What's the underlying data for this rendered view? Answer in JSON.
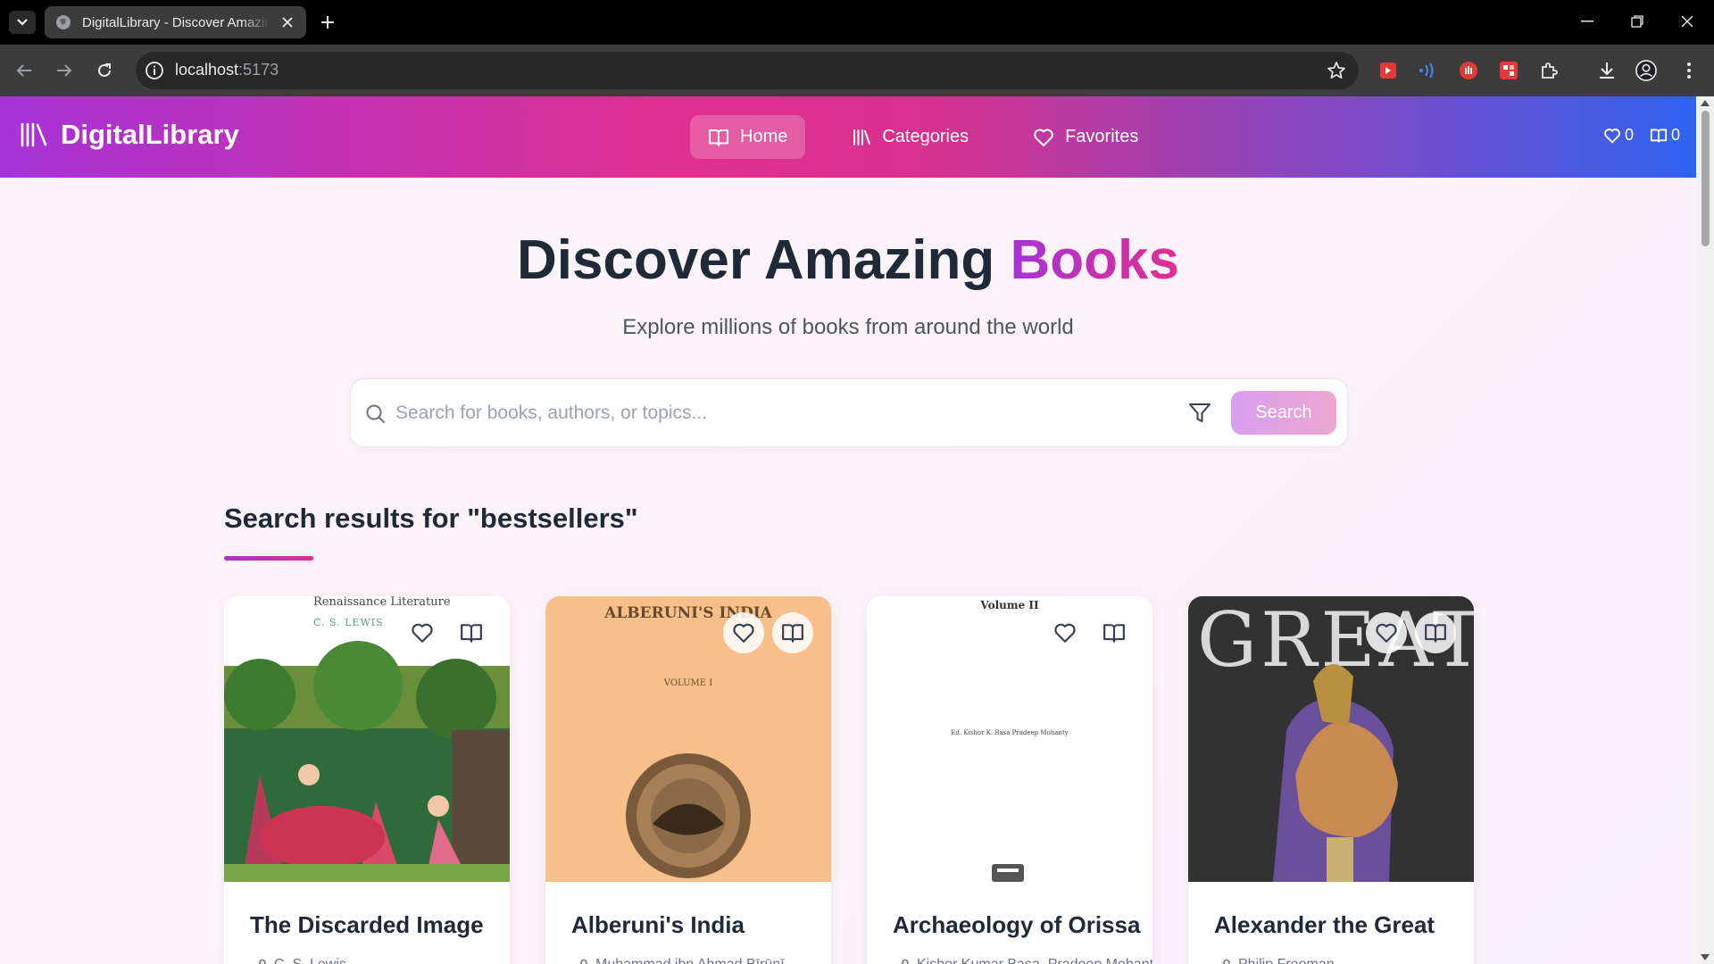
{
  "browser": {
    "tab_title": "DigitalLibrary - Discover Amazing Books",
    "url_host": "localhost",
    "url_port": ":5173"
  },
  "app": {
    "brand": "DigitalLibrary",
    "nav": [
      {
        "label": "Home",
        "icon": "book-open-icon",
        "active": true
      },
      {
        "label": "Categories",
        "icon": "library-icon",
        "active": false
      },
      {
        "label": "Favorites",
        "icon": "heart-icon",
        "active": false
      }
    ],
    "favorites_count": "0",
    "reading_count": "0"
  },
  "hero": {
    "title_main": "Discover Amazing ",
    "title_accent": "Books",
    "subtitle": "Explore millions of books from around the world"
  },
  "search": {
    "placeholder": "Search for books, authors, or topics...",
    "value": "",
    "button_label": "Search"
  },
  "results": {
    "heading": "Search results for \"bestsellers\"",
    "books": [
      {
        "title": "The Discarded Image",
        "author": "C. S. Lewis",
        "cover_text_top": "Renaissance Literature",
        "cover_text_sub": "C. S. LEWIS"
      },
      {
        "title": "Alberuni's India",
        "author": "Muhammad ibn Ahmad Bīrūnī",
        "cover_text_top": "ALBERUNI'S INDIA",
        "cover_text_sub": "VOLUME I"
      },
      {
        "title": "Archaeology of Orissa",
        "author": "Kishor Kumar Basa, Pradeep Mohanty",
        "cover_text_top": "Volume II",
        "cover_text_sub": "Ed. Kishor K. Basa Pradeep Mohanty"
      },
      {
        "title": "Alexander the Great",
        "author": "Philip Freeman",
        "cover_text_top": "GREAT",
        "cover_text_sub": ""
      }
    ]
  },
  "colors": {
    "brand_purple": "#a633d8",
    "brand_pink": "#e02f8f",
    "brand_blue": "#2f63f0"
  }
}
